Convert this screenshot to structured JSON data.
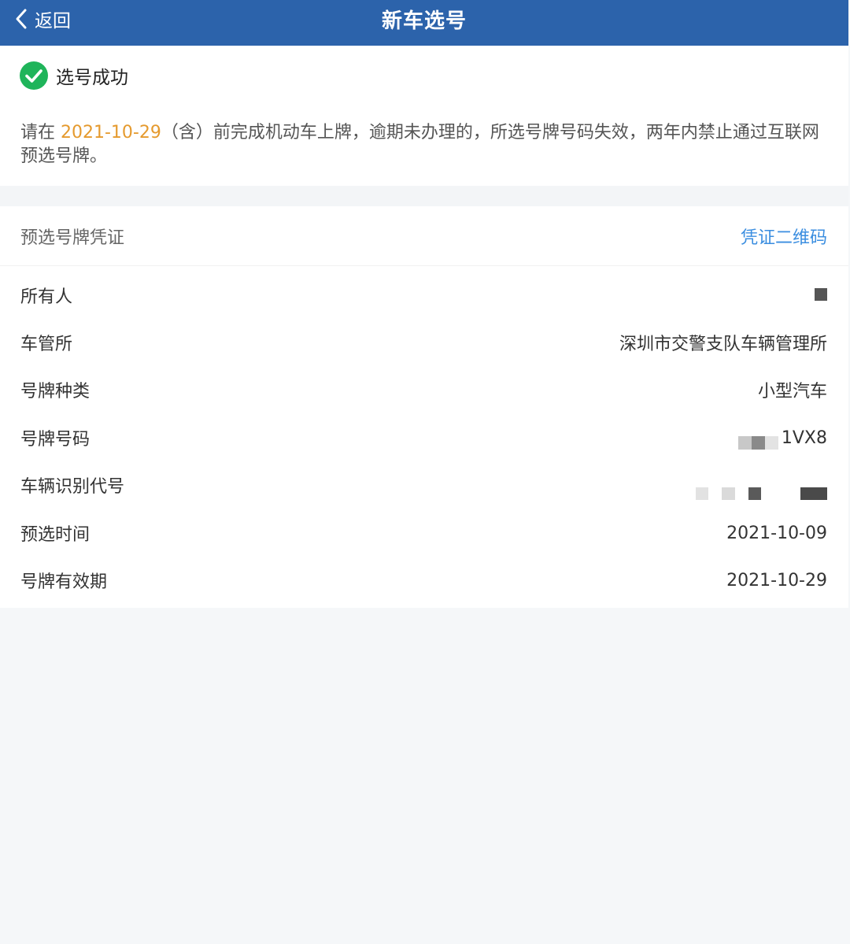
{
  "header": {
    "back_label": "返回",
    "title": "新车选号",
    "bg_color": "#2c63ab"
  },
  "notice": {
    "status": "选号成功",
    "text_before": "请在 ",
    "deadline": "2021-10-29",
    "text_after": "（含）前完成机动车上牌，逾期未办理的，所选号牌号码失效，两年内禁止通过互联网预选号牌。",
    "accent_color": "#e59a2e"
  },
  "card": {
    "title": "预选号牌凭证",
    "qr_link": "凭证二维码",
    "rows": [
      {
        "label": "所有人",
        "value": ""
      },
      {
        "label": "车管所",
        "value": "深圳市交警支队车辆管理所"
      },
      {
        "label": "号牌种类",
        "value": "小型汽车"
      },
      {
        "label": "号牌号码",
        "value": "1VX8"
      },
      {
        "label": "车辆识别代号",
        "value": ""
      },
      {
        "label": "预选时间",
        "value": "2021-10-09"
      },
      {
        "label": "号牌有效期",
        "value": "2021-10-29"
      }
    ]
  },
  "icons": {
    "back": "chevron-left-icon",
    "success": "check-circle-icon"
  }
}
